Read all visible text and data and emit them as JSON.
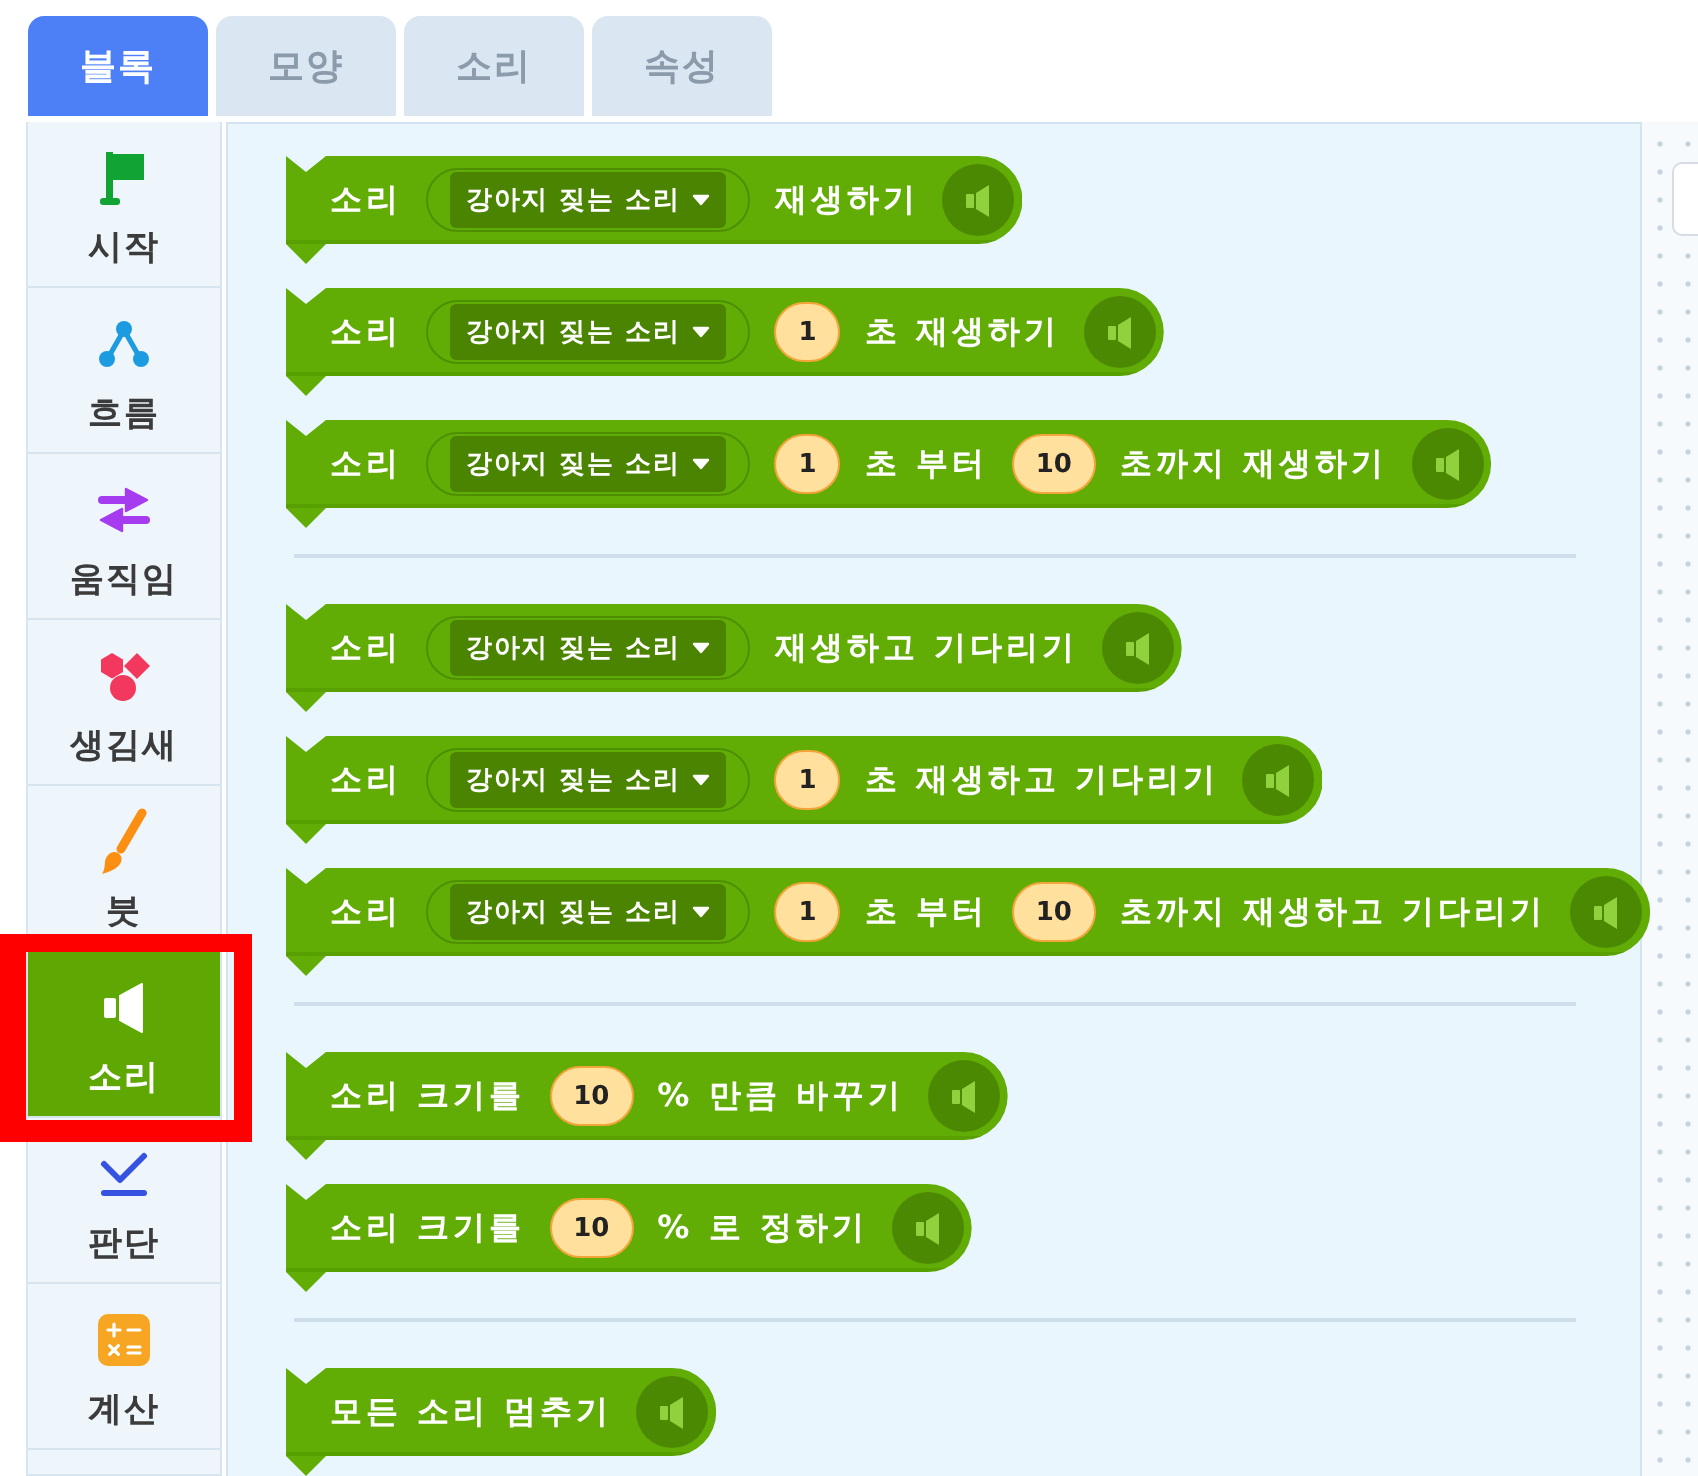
{
  "tabs": [
    {
      "label": "블록",
      "selected": true
    },
    {
      "label": "모양",
      "selected": false
    },
    {
      "label": "소리",
      "selected": false
    },
    {
      "label": "속성",
      "selected": false
    }
  ],
  "categories": [
    {
      "label": "시작",
      "selected": false,
      "highlighted": false
    },
    {
      "label": "흐름",
      "selected": false,
      "highlighted": false
    },
    {
      "label": "움직임",
      "selected": false,
      "highlighted": false
    },
    {
      "label": "생김새",
      "selected": false,
      "highlighted": false
    },
    {
      "label": "붓",
      "selected": false,
      "highlighted": false
    },
    {
      "label": "소리",
      "selected": true,
      "highlighted": true
    },
    {
      "label": "판단",
      "selected": false,
      "highlighted": false
    },
    {
      "label": "계산",
      "selected": false,
      "highlighted": false
    }
  ],
  "block_groups": [
    [
      {
        "parts": [
          {
            "kind": "text",
            "text": "소리"
          },
          {
            "kind": "dropdown",
            "text": "강아지 짖는 소리"
          },
          {
            "kind": "text",
            "text": "재생하기"
          }
        ]
      },
      {
        "parts": [
          {
            "kind": "text",
            "text": "소리"
          },
          {
            "kind": "dropdown",
            "text": "강아지 짖는 소리"
          },
          {
            "kind": "number",
            "text": "1"
          },
          {
            "kind": "text",
            "text": "초 재생하기"
          }
        ]
      },
      {
        "parts": [
          {
            "kind": "text",
            "text": "소리"
          },
          {
            "kind": "dropdown",
            "text": "강아지 짖는 소리"
          },
          {
            "kind": "number",
            "text": "1"
          },
          {
            "kind": "text",
            "text": "초 부터"
          },
          {
            "kind": "number",
            "text": "10"
          },
          {
            "kind": "text",
            "text": "초까지 재생하기"
          }
        ]
      }
    ],
    [
      {
        "parts": [
          {
            "kind": "text",
            "text": "소리"
          },
          {
            "kind": "dropdown",
            "text": "강아지 짖는 소리"
          },
          {
            "kind": "text",
            "text": "재생하고 기다리기"
          }
        ]
      },
      {
        "parts": [
          {
            "kind": "text",
            "text": "소리"
          },
          {
            "kind": "dropdown",
            "text": "강아지 짖는 소리"
          },
          {
            "kind": "number",
            "text": "1"
          },
          {
            "kind": "text",
            "text": "초 재생하고 기다리기"
          }
        ]
      },
      {
        "parts": [
          {
            "kind": "text",
            "text": "소리"
          },
          {
            "kind": "dropdown",
            "text": "강아지 짖는 소리"
          },
          {
            "kind": "number",
            "text": "1"
          },
          {
            "kind": "text",
            "text": "초 부터"
          },
          {
            "kind": "number",
            "text": "10"
          },
          {
            "kind": "text",
            "text": "초까지 재생하고 기다리기"
          }
        ]
      }
    ],
    [
      {
        "parts": [
          {
            "kind": "text",
            "text": "소리 크기를"
          },
          {
            "kind": "number",
            "text": "10"
          },
          {
            "kind": "text",
            "text": "% 만큼 바꾸기"
          }
        ]
      },
      {
        "parts": [
          {
            "kind": "text",
            "text": "소리 크기를"
          },
          {
            "kind": "number",
            "text": "10"
          },
          {
            "kind": "text",
            "text": "% 로 정하기"
          }
        ]
      }
    ],
    [
      {
        "parts": [
          {
            "kind": "text",
            "text": "모든 소리 멈추기"
          }
        ]
      }
    ]
  ]
}
